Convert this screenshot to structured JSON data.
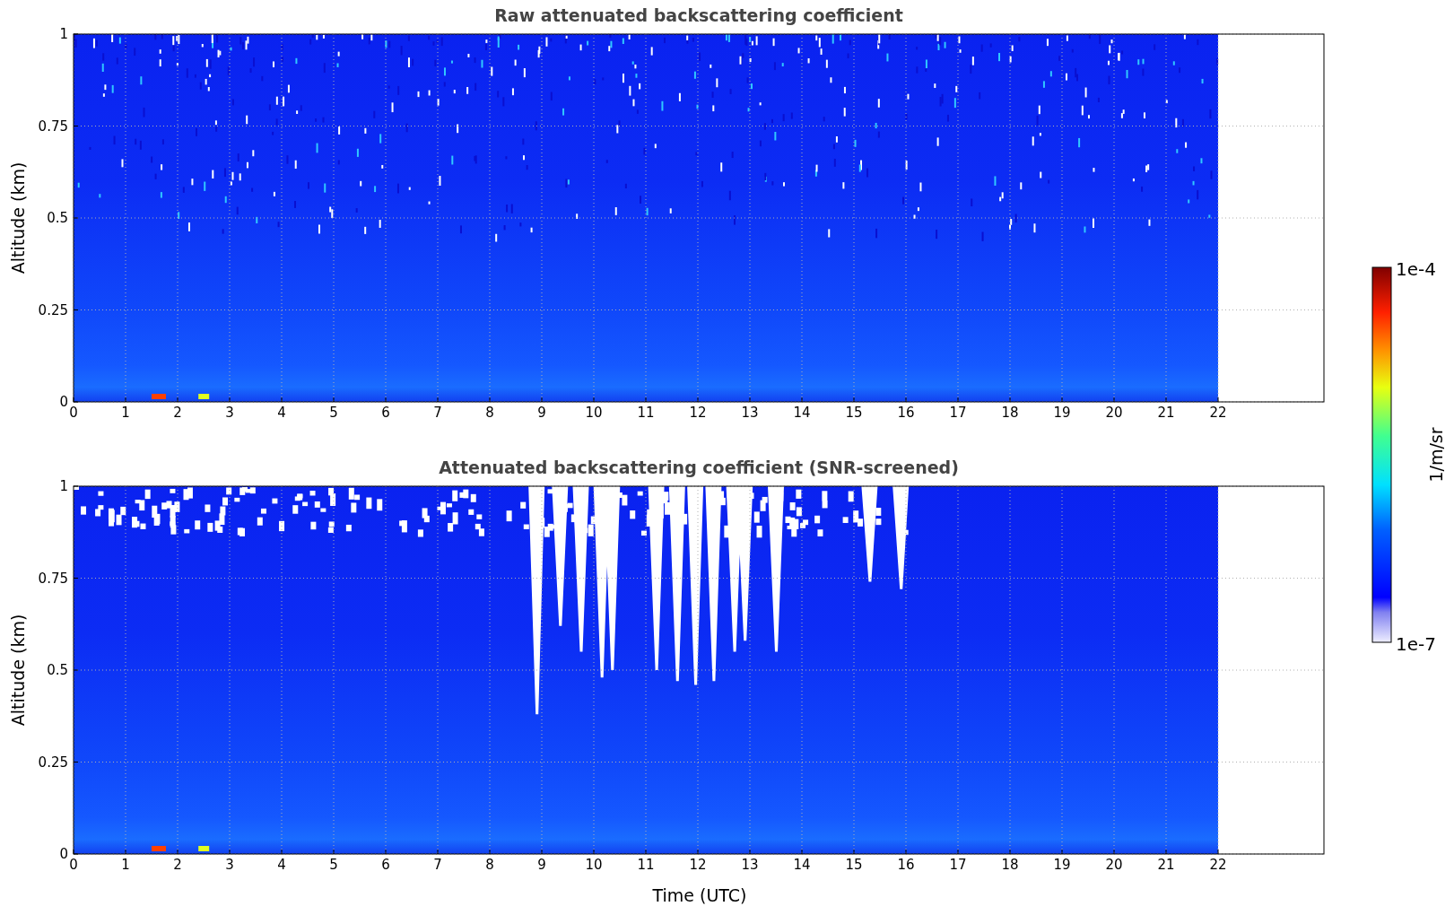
{
  "panels": [
    {
      "title": "Raw attenuated backscattering coefficient",
      "ylabel": "Altitude (km)",
      "screened": false,
      "yticks": [
        "1",
        "0.75",
        "0.5",
        "0.25",
        "0"
      ],
      "xticks": [
        "0",
        "1",
        "2",
        "3",
        "4",
        "5",
        "6",
        "7",
        "8",
        "9",
        "10",
        "11",
        "12",
        "13",
        "14",
        "15",
        "16",
        "17",
        "18",
        "19",
        "20",
        "21",
        "22"
      ]
    },
    {
      "title": "Attenuated backscattering coefficient (SNR-screened)",
      "ylabel": "Altitude (km)",
      "screened": true,
      "yticks": [
        "1",
        "0.75",
        "0.5",
        "0.25",
        "0"
      ],
      "xticks": [
        "0",
        "1",
        "2",
        "3",
        "4",
        "5",
        "6",
        "7",
        "8",
        "9",
        "10",
        "11",
        "12",
        "13",
        "14",
        "15",
        "16",
        "17",
        "18",
        "19",
        "20",
        "21",
        "22"
      ]
    }
  ],
  "xlabel": "Time (UTC)",
  "colorbar": {
    "max_label": "1e-4",
    "min_label": "1e-7",
    "label": "1/m/sr"
  }
}
